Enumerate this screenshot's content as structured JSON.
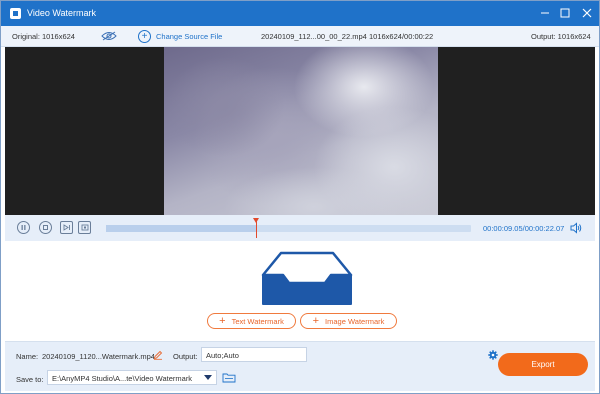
{
  "window": {
    "title": "Video Watermark",
    "icons": {
      "minimize": "minimize-icon",
      "maximize": "maximize-icon",
      "close": "close-icon"
    }
  },
  "infobar": {
    "original": "Original: 1016x624",
    "change_source": "Change Source File",
    "file_name": "20240109_112...00_00_22.mp4",
    "file_info": "1016x624/00:00:22",
    "output": "Output: 1016x624"
  },
  "playback": {
    "time": "00:00:09.05/00:00:22.07",
    "progress": 0.41,
    "icons": [
      "pause-icon",
      "stop-icon",
      "next-frame-icon",
      "loop-icon",
      "volume-icon"
    ]
  },
  "watermark": {
    "text_button": "Text Watermark",
    "image_button": "Image Watermark"
  },
  "bottom": {
    "name_label": "Name:",
    "name_value": "20240109_1120...Watermark.mp4",
    "output_label": "Output:",
    "output_value": "Auto;Auto",
    "save_label": "Save to:",
    "save_value": "E:\\AnyMP4 Studio\\A...te\\Video Watermark",
    "export_label": "Export"
  },
  "colors": {
    "titlebar": "#1f72c9",
    "accent": "#1f72c9",
    "export": "#f26a1b",
    "watermark_btn": "#e8652b",
    "playhead": "#e24a2c"
  }
}
